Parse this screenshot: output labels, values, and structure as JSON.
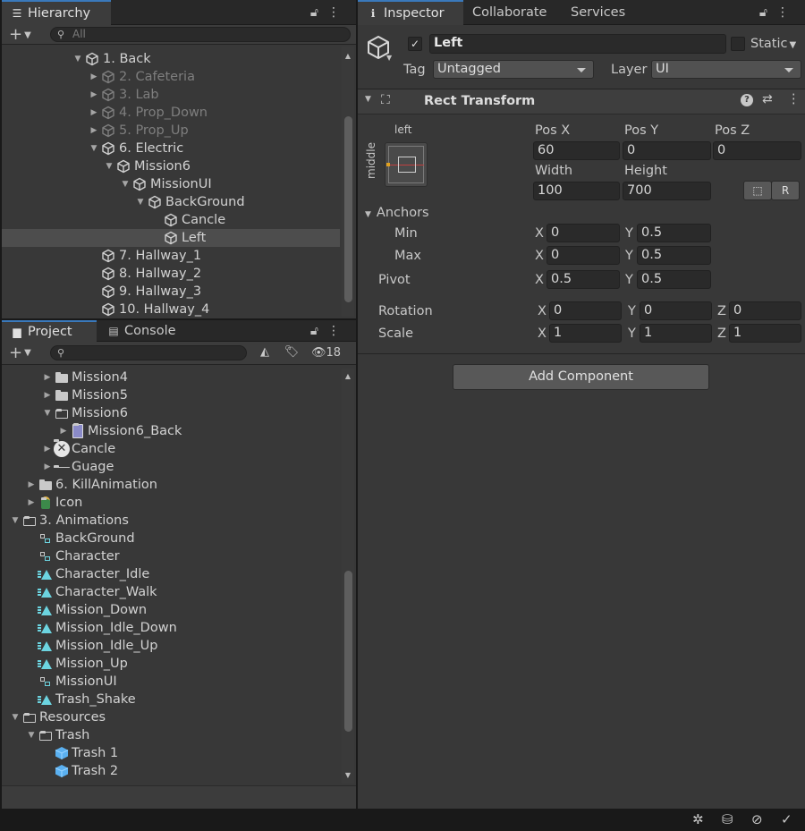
{
  "hierarchy": {
    "tab_label": "Hierarchy",
    "search_placeholder": "All",
    "items": [
      {
        "label": "1. Back",
        "arrow": "▼",
        "dim": false,
        "sel": false
      },
      {
        "label": "2. Cafeteria",
        "arrow": "▶",
        "dim": true,
        "sel": false
      },
      {
        "label": "3. Lab",
        "arrow": "▶",
        "dim": true,
        "sel": false
      },
      {
        "label": "4. Prop_Down",
        "arrow": "▶",
        "dim": true,
        "sel": false
      },
      {
        "label": "5. Prop_Up",
        "arrow": "▶",
        "dim": true,
        "sel": false
      },
      {
        "label": "6. Electric",
        "arrow": "▼",
        "dim": false,
        "sel": false
      },
      {
        "label": "Mission6",
        "arrow": "▼",
        "dim": false,
        "sel": false
      },
      {
        "label": "MissionUI",
        "arrow": "▼",
        "dim": false,
        "sel": false
      },
      {
        "label": "BackGround",
        "arrow": "▼",
        "dim": false,
        "sel": false
      },
      {
        "label": "Cancle",
        "arrow": "",
        "dim": false,
        "sel": false
      },
      {
        "label": "Left",
        "arrow": "",
        "dim": false,
        "sel": true
      },
      {
        "label": "7. Hallway_1",
        "arrow": "",
        "dim": false,
        "sel": false
      },
      {
        "label": "8. Hallway_2",
        "arrow": "",
        "dim": false,
        "sel": false
      },
      {
        "label": "9. Hallway_3",
        "arrow": "",
        "dim": false,
        "sel": false
      },
      {
        "label": "10. Hallway_4",
        "arrow": "",
        "dim": false,
        "sel": false
      }
    ]
  },
  "project": {
    "tab_project": "Project",
    "tab_console": "Console",
    "hidden_count": "18",
    "items": [
      {
        "label": "Mission4",
        "arrow": "▶",
        "icon": "folder"
      },
      {
        "label": "Mission5",
        "arrow": "▶",
        "icon": "folder"
      },
      {
        "label": "Mission6",
        "arrow": "▼",
        "icon": "folder-open"
      },
      {
        "label": "Mission6_Back",
        "arrow": "▶",
        "icon": "sprite"
      },
      {
        "label": "Cancle",
        "arrow": "▶",
        "icon": "x-circle"
      },
      {
        "label": "Guage",
        "arrow": "▶",
        "icon": "line"
      },
      {
        "label": "6. KillAnimation",
        "arrow": "▶",
        "icon": "folder"
      },
      {
        "label": "Icon",
        "arrow": "▶",
        "icon": "character"
      },
      {
        "label": "3. Animations",
        "arrow": "▼",
        "icon": "folder-open"
      },
      {
        "label": "BackGround",
        "arrow": "",
        "icon": "controller"
      },
      {
        "label": "Character",
        "arrow": "",
        "icon": "controller"
      },
      {
        "label": "Character_Idle",
        "arrow": "",
        "icon": "anim"
      },
      {
        "label": "Character_Walk",
        "arrow": "",
        "icon": "anim"
      },
      {
        "label": "Mission_Down",
        "arrow": "",
        "icon": "anim"
      },
      {
        "label": "Mission_Idle_Down",
        "arrow": "",
        "icon": "anim"
      },
      {
        "label": "Mission_Idle_Up",
        "arrow": "",
        "icon": "anim"
      },
      {
        "label": "Mission_Up",
        "arrow": "",
        "icon": "anim"
      },
      {
        "label": "MissionUI",
        "arrow": "",
        "icon": "controller"
      },
      {
        "label": "Trash_Shake",
        "arrow": "",
        "icon": "anim"
      },
      {
        "label": "Resources",
        "arrow": "▼",
        "icon": "folder-open"
      },
      {
        "label": "Trash",
        "arrow": "▼",
        "icon": "folder-open"
      },
      {
        "label": "Trash 1",
        "arrow": "",
        "icon": "prefab"
      },
      {
        "label": "Trash 2",
        "arrow": "",
        "icon": "prefab"
      }
    ]
  },
  "inspector": {
    "tabs": [
      "Inspector",
      "Collaborate",
      "Services"
    ],
    "object_name": "Left",
    "static_label": "Static",
    "tag_label": "Tag",
    "tag_value": "Untagged",
    "layer_label": "Layer",
    "layer_value": "UI",
    "component_title": "Rect Transform",
    "anchor_preset_top": "left",
    "anchor_preset_side": "middle",
    "pos_x_label": "Pos X",
    "pos_x": "60",
    "pos_y_label": "Pos Y",
    "pos_y": "0",
    "pos_z_label": "Pos Z",
    "pos_z": "0",
    "width_label": "Width",
    "width": "100",
    "height_label": "Height",
    "height": "700",
    "anchors_label": "Anchors",
    "min_label": "Min",
    "min_x": "0",
    "min_y": "0.5",
    "max_label": "Max",
    "max_x": "0",
    "max_y": "0.5",
    "pivot_label": "Pivot",
    "pivot_x": "0.5",
    "pivot_y": "0.5",
    "rotation_label": "Rotation",
    "rot_x": "0",
    "rot_y": "0",
    "rot_z": "0",
    "scale_label": "Scale",
    "scale_x": "1",
    "scale_y": "1",
    "scale_z": "1",
    "axis_x": "X",
    "axis_y": "Y",
    "axis_z": "Z",
    "raw_button": "R",
    "add_component": "Add Component"
  },
  "colors": {
    "accent": "#3a79bb",
    "panel": "#383838",
    "field": "#2a2a2a",
    "anim_icon": "#6cd4e0",
    "prefab_icon": "#5ab0f0"
  }
}
